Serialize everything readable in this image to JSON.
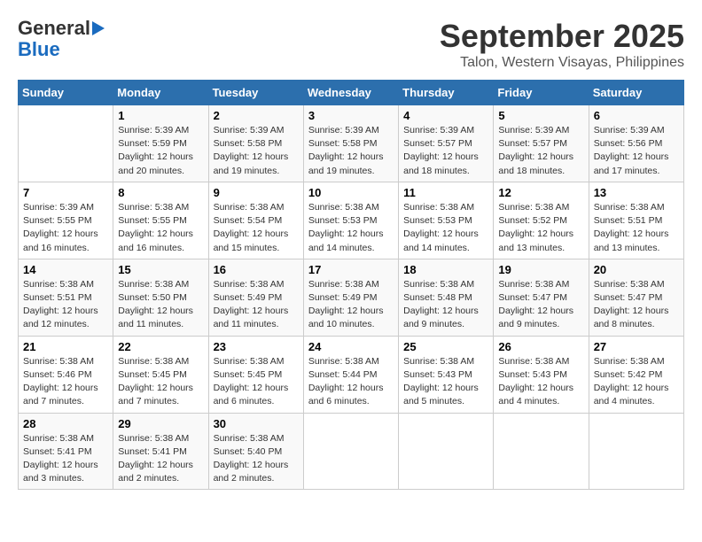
{
  "header": {
    "logo_line1": "General",
    "logo_line2": "Blue",
    "month": "September 2025",
    "location": "Talon, Western Visayas, Philippines"
  },
  "days_of_week": [
    "Sunday",
    "Monday",
    "Tuesday",
    "Wednesday",
    "Thursday",
    "Friday",
    "Saturday"
  ],
  "weeks": [
    [
      {
        "day": "",
        "info": ""
      },
      {
        "day": "1",
        "info": "Sunrise: 5:39 AM\nSunset: 5:59 PM\nDaylight: 12 hours\nand 20 minutes."
      },
      {
        "day": "2",
        "info": "Sunrise: 5:39 AM\nSunset: 5:58 PM\nDaylight: 12 hours\nand 19 minutes."
      },
      {
        "day": "3",
        "info": "Sunrise: 5:39 AM\nSunset: 5:58 PM\nDaylight: 12 hours\nand 19 minutes."
      },
      {
        "day": "4",
        "info": "Sunrise: 5:39 AM\nSunset: 5:57 PM\nDaylight: 12 hours\nand 18 minutes."
      },
      {
        "day": "5",
        "info": "Sunrise: 5:39 AM\nSunset: 5:57 PM\nDaylight: 12 hours\nand 18 minutes."
      },
      {
        "day": "6",
        "info": "Sunrise: 5:39 AM\nSunset: 5:56 PM\nDaylight: 12 hours\nand 17 minutes."
      }
    ],
    [
      {
        "day": "7",
        "info": "Sunrise: 5:39 AM\nSunset: 5:55 PM\nDaylight: 12 hours\nand 16 minutes."
      },
      {
        "day": "8",
        "info": "Sunrise: 5:38 AM\nSunset: 5:55 PM\nDaylight: 12 hours\nand 16 minutes."
      },
      {
        "day": "9",
        "info": "Sunrise: 5:38 AM\nSunset: 5:54 PM\nDaylight: 12 hours\nand 15 minutes."
      },
      {
        "day": "10",
        "info": "Sunrise: 5:38 AM\nSunset: 5:53 PM\nDaylight: 12 hours\nand 14 minutes."
      },
      {
        "day": "11",
        "info": "Sunrise: 5:38 AM\nSunset: 5:53 PM\nDaylight: 12 hours\nand 14 minutes."
      },
      {
        "day": "12",
        "info": "Sunrise: 5:38 AM\nSunset: 5:52 PM\nDaylight: 12 hours\nand 13 minutes."
      },
      {
        "day": "13",
        "info": "Sunrise: 5:38 AM\nSunset: 5:51 PM\nDaylight: 12 hours\nand 13 minutes."
      }
    ],
    [
      {
        "day": "14",
        "info": "Sunrise: 5:38 AM\nSunset: 5:51 PM\nDaylight: 12 hours\nand 12 minutes."
      },
      {
        "day": "15",
        "info": "Sunrise: 5:38 AM\nSunset: 5:50 PM\nDaylight: 12 hours\nand 11 minutes."
      },
      {
        "day": "16",
        "info": "Sunrise: 5:38 AM\nSunset: 5:49 PM\nDaylight: 12 hours\nand 11 minutes."
      },
      {
        "day": "17",
        "info": "Sunrise: 5:38 AM\nSunset: 5:49 PM\nDaylight: 12 hours\nand 10 minutes."
      },
      {
        "day": "18",
        "info": "Sunrise: 5:38 AM\nSunset: 5:48 PM\nDaylight: 12 hours\nand 9 minutes."
      },
      {
        "day": "19",
        "info": "Sunrise: 5:38 AM\nSunset: 5:47 PM\nDaylight: 12 hours\nand 9 minutes."
      },
      {
        "day": "20",
        "info": "Sunrise: 5:38 AM\nSunset: 5:47 PM\nDaylight: 12 hours\nand 8 minutes."
      }
    ],
    [
      {
        "day": "21",
        "info": "Sunrise: 5:38 AM\nSunset: 5:46 PM\nDaylight: 12 hours\nand 7 minutes."
      },
      {
        "day": "22",
        "info": "Sunrise: 5:38 AM\nSunset: 5:45 PM\nDaylight: 12 hours\nand 7 minutes."
      },
      {
        "day": "23",
        "info": "Sunrise: 5:38 AM\nSunset: 5:45 PM\nDaylight: 12 hours\nand 6 minutes."
      },
      {
        "day": "24",
        "info": "Sunrise: 5:38 AM\nSunset: 5:44 PM\nDaylight: 12 hours\nand 6 minutes."
      },
      {
        "day": "25",
        "info": "Sunrise: 5:38 AM\nSunset: 5:43 PM\nDaylight: 12 hours\nand 5 minutes."
      },
      {
        "day": "26",
        "info": "Sunrise: 5:38 AM\nSunset: 5:43 PM\nDaylight: 12 hours\nand 4 minutes."
      },
      {
        "day": "27",
        "info": "Sunrise: 5:38 AM\nSunset: 5:42 PM\nDaylight: 12 hours\nand 4 minutes."
      }
    ],
    [
      {
        "day": "28",
        "info": "Sunrise: 5:38 AM\nSunset: 5:41 PM\nDaylight: 12 hours\nand 3 minutes."
      },
      {
        "day": "29",
        "info": "Sunrise: 5:38 AM\nSunset: 5:41 PM\nDaylight: 12 hours\nand 2 minutes."
      },
      {
        "day": "30",
        "info": "Sunrise: 5:38 AM\nSunset: 5:40 PM\nDaylight: 12 hours\nand 2 minutes."
      },
      {
        "day": "",
        "info": ""
      },
      {
        "day": "",
        "info": ""
      },
      {
        "day": "",
        "info": ""
      },
      {
        "day": "",
        "info": ""
      }
    ]
  ]
}
